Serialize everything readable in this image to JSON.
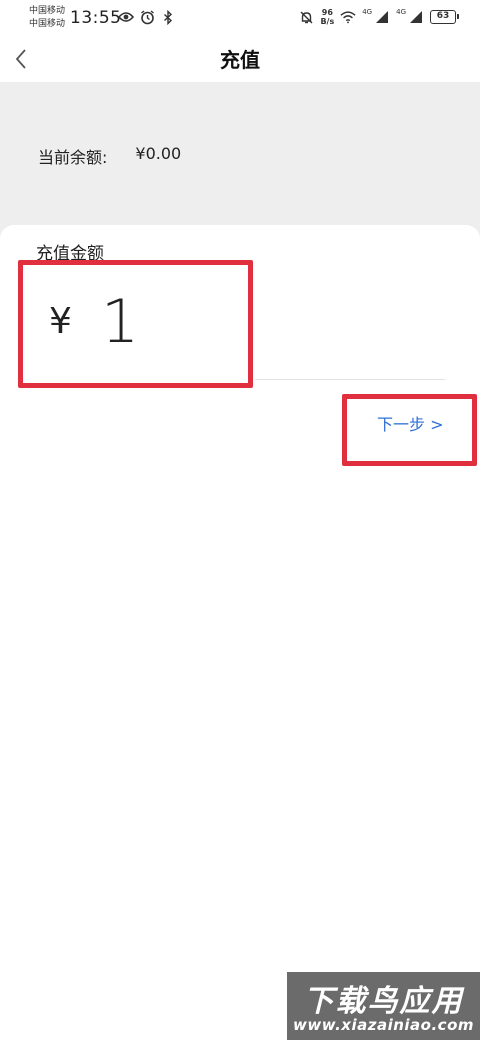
{
  "status_bar": {
    "carrier1": "中国移动",
    "carrier2": "中国移动",
    "time": "13:55",
    "net_speed_value": "96",
    "net_speed_unit": "B/s",
    "signal1_label": "4G",
    "signal2_label": "4G",
    "battery": "63"
  },
  "nav": {
    "title": "充值"
  },
  "balance": {
    "label": "当前余额:",
    "value": "¥0.00"
  },
  "recharge": {
    "title": "充值金额",
    "currency": "¥",
    "amount": "1",
    "next_label": "下一步 >"
  },
  "watermark": {
    "text": "下载鸟应用",
    "url": "www.xiazainiao.com"
  },
  "colors": {
    "highlight": "#e0303f",
    "link": "#2e6fd6",
    "panel_bg": "#eeeeee"
  }
}
